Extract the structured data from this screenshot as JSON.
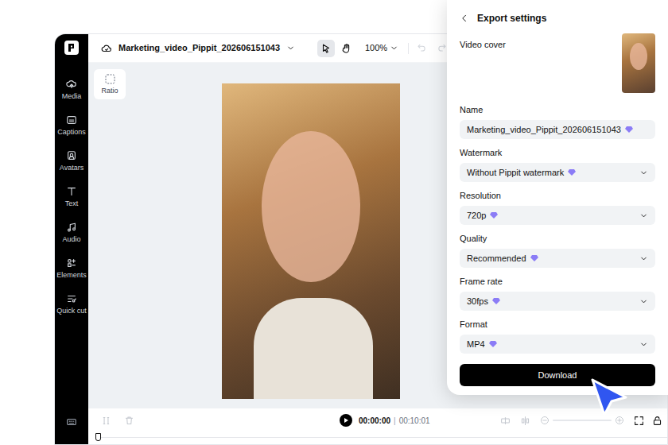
{
  "editor": {
    "title": "Marketing_video_Pippit_202606151043",
    "zoom": "100%",
    "tools": [
      {
        "tool": "select",
        "selected": true
      },
      {
        "tool": "hand",
        "selected": false
      }
    ],
    "undo": {
      "disabled": true
    },
    "redo": {
      "disabled": true
    }
  },
  "sidebar": {
    "items": [
      {
        "label": "Media"
      },
      {
        "label": "Captions"
      },
      {
        "label": "Avatars"
      },
      {
        "label": "Text"
      },
      {
        "label": "Audio"
      },
      {
        "label": "Elements"
      },
      {
        "label": "Quick cut"
      }
    ]
  },
  "canvas": {
    "ratio_button": "Ratio"
  },
  "timeline": {
    "current": "00:00:00",
    "separator": "|",
    "total": "00:10:01"
  },
  "export": {
    "title": "Export settings",
    "cover_label": "Video cover",
    "fields": [
      {
        "label": "Name",
        "value": "Marketing_video_Pippit_202606151043",
        "kind": "input",
        "premium": false
      },
      {
        "label": "Watermark",
        "value": "Without Pippit watermark",
        "kind": "select",
        "premium": true
      },
      {
        "label": "Resolution",
        "value": "720p",
        "kind": "select",
        "premium": false
      },
      {
        "label": "Quality",
        "value": "Recommended",
        "kind": "select",
        "premium": false
      },
      {
        "label": "Frame rate",
        "value": "30fps",
        "kind": "select",
        "premium": false
      },
      {
        "label": "Format",
        "value": "MP4",
        "kind": "select",
        "premium": false
      }
    ],
    "download": "Download"
  }
}
